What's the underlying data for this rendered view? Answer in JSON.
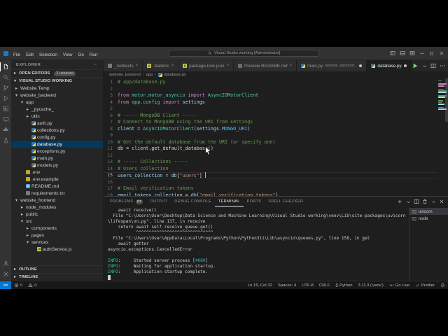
{
  "colors": {
    "accent": "#007acc",
    "remote_badge": "#0078d4",
    "selection": "#04395e",
    "activity_bar": "#333333",
    "sidebar": "#252526",
    "editor_bg": "#1e1e1e"
  },
  "titlebar": {
    "menus": [
      "File",
      "Edit",
      "Selection",
      "View",
      "Go",
      "Run"
    ],
    "command_center": "Visual Studio working [Administrator]",
    "layout_controls": [
      {
        "name": "toggle-sidebar",
        "icon": "layout-sidebar"
      },
      {
        "name": "toggle-panel",
        "icon": "layout-panel"
      },
      {
        "name": "customize-layout",
        "icon": "layout-custom"
      }
    ],
    "window_controls": [
      {
        "name": "minimize",
        "icon": "min"
      },
      {
        "name": "maximize",
        "icon": "max"
      },
      {
        "name": "close-window",
        "icon": "close"
      }
    ]
  },
  "activity_bar": {
    "top": [
      {
        "name": "explorer",
        "icon": "files",
        "active": true
      },
      {
        "name": "search",
        "icon": "search",
        "active": false
      },
      {
        "name": "source-control",
        "icon": "source-control",
        "active": false
      },
      {
        "name": "run-debug",
        "icon": "debug",
        "active": false
      },
      {
        "name": "extensions",
        "icon": "extensions",
        "active": false
      },
      {
        "name": "remote-explorer",
        "icon": "remote-window",
        "active": false
      },
      {
        "name": "docker",
        "icon": "docker",
        "active": false
      },
      {
        "name": "testing",
        "icon": "beaker",
        "active": false
      }
    ],
    "bottom": [
      {
        "name": "accounts",
        "icon": "account"
      },
      {
        "name": "settings",
        "icon": "gear"
      }
    ]
  },
  "sidebar": {
    "title": "EXPLORER",
    "open_editors": {
      "label": "OPEN EDITORS",
      "badge": "2 unsaved"
    },
    "root_label": "VISUAL STUDIO WORKING",
    "outline_label": "OUTLINE",
    "timeline_label": "TIMELINE",
    "tree": [
      {
        "label": "Website Temp",
        "indent": 0,
        "chev": "right",
        "icon": "folder"
      },
      {
        "label": "website_backend",
        "indent": 0,
        "chev": "down",
        "icon": "folder"
      },
      {
        "label": "app",
        "indent": 1,
        "chev": "down",
        "icon": "folder"
      },
      {
        "label": "_pycache_",
        "indent": 2,
        "chev": "right",
        "icon": "folder"
      },
      {
        "label": "utils",
        "indent": 2,
        "chev": "right",
        "icon": "folder"
      },
      {
        "label": "auth.py",
        "indent": 2,
        "icon": "py"
      },
      {
        "label": "collections.py",
        "indent": 2,
        "icon": "py"
      },
      {
        "label": "config.py",
        "indent": 2,
        "icon": "py"
      },
      {
        "label": "database.py",
        "indent": 2,
        "icon": "py",
        "selected": true
      },
      {
        "label": "exceptions.py",
        "indent": 2,
        "icon": "py"
      },
      {
        "label": "main.py",
        "indent": 2,
        "icon": "py"
      },
      {
        "label": "models.py",
        "indent": 2,
        "icon": "py"
      },
      {
        "label": ".env",
        "indent": 1,
        "icon": "env"
      },
      {
        "label": ".env.example",
        "indent": 1,
        "icon": "env"
      },
      {
        "label": "README.md",
        "indent": 1,
        "icon": "md"
      },
      {
        "label": "requirements.txt",
        "indent": 1,
        "icon": "txt"
      },
      {
        "label": "website_frontend",
        "indent": 0,
        "chev": "down",
        "icon": "folder"
      },
      {
        "label": "node_modules",
        "indent": 1,
        "chev": "right",
        "icon": "folder"
      },
      {
        "label": "public",
        "indent": 1,
        "chev": "right",
        "icon": "folder"
      },
      {
        "label": "src",
        "indent": 1,
        "chev": "down",
        "icon": "folder"
      },
      {
        "label": "components",
        "indent": 2,
        "chev": "right",
        "icon": "folder"
      },
      {
        "label": "pages",
        "indent": 2,
        "chev": "right",
        "icon": "folder"
      },
      {
        "label": "services",
        "indent": 2,
        "chev": "down",
        "icon": "folder"
      },
      {
        "label": "authService.js",
        "indent": 3,
        "icon": "js"
      }
    ]
  },
  "tabs": [
    {
      "label": "_redirects",
      "icon": "txt",
      "modified": false,
      "active": false
    },
    {
      "label": ".babelrc",
      "icon": "json",
      "modified": false,
      "active": false
    },
    {
      "label": "package-lock.json",
      "icon": "json",
      "modified": false,
      "active": false
    },
    {
      "label": "Preview README.md",
      "icon": "preview",
      "modified": false,
      "active": false
    },
    {
      "label": "main.py",
      "desc": "website_backend...",
      "icon": "py",
      "modified": true,
      "active": false
    },
    {
      "label": "database.py",
      "icon": "py",
      "modified": true,
      "active": true
    }
  ],
  "tab_actions": [
    {
      "name": "run-python-file",
      "icon": "play",
      "color": "#89d185"
    },
    {
      "name": "run-dropdown",
      "icon": "chevron-down",
      "color": "#c0c0c0"
    },
    {
      "name": "split-editor",
      "icon": "split",
      "color": "#c0c0c0"
    },
    {
      "name": "more-actions",
      "icon": "ellipsis",
      "color": "#c0c0c0"
    }
  ],
  "breadcrumb": [
    {
      "label": "website_backend"
    },
    {
      "label": "app"
    },
    {
      "label": "database.py",
      "icon": "py"
    }
  ],
  "editor": {
    "current_line": 15,
    "cursor_col": 32,
    "lines": [
      [
        {
          "t": "# app/database.py",
          "c": "cm"
        }
      ],
      [],
      [
        {
          "t": "from ",
          "c": "kw"
        },
        {
          "t": "motor.motor_asyncio ",
          "c": "ty"
        },
        {
          "t": "import ",
          "c": "kw"
        },
        {
          "t": "AsyncIOMotorClient",
          "c": "ty"
        }
      ],
      [
        {
          "t": "from ",
          "c": "kw"
        },
        {
          "t": "app.config ",
          "c": "ty"
        },
        {
          "t": "import ",
          "c": "kw"
        },
        {
          "t": "settings",
          "c": "vr"
        }
      ],
      [],
      [
        {
          "t": "# ----- MongoDB Client -----",
          "c": "cm"
        }
      ],
      [
        {
          "t": "# Connect to MongoDB using the URI from settings",
          "c": "cm"
        }
      ],
      [
        {
          "t": "client",
          "c": "vr"
        },
        {
          "t": " = ",
          "c": "df"
        },
        {
          "t": "AsyncIOMotorClient",
          "c": "ty"
        },
        {
          "t": "(",
          "c": "df"
        },
        {
          "t": "settings",
          "c": "vr"
        },
        {
          "t": ".",
          "c": "df"
        },
        {
          "t": "MONGO_URI",
          "c": "ct"
        },
        {
          "t": ")",
          "c": "df"
        }
      ],
      [],
      [
        {
          "t": "# Get the default database from the URI (or specify one)",
          "c": "cm"
        }
      ],
      [
        {
          "t": "db",
          "c": "vr"
        },
        {
          "t": " = ",
          "c": "df"
        },
        {
          "t": "client",
          "c": "vr"
        },
        {
          "t": ".",
          "c": "df"
        },
        {
          "t": "get_default_database",
          "c": "fn"
        },
        {
          "t": "()",
          "c": "df"
        }
      ],
      [],
      [
        {
          "t": "# ----- Collections -----",
          "c": "cm"
        }
      ],
      [
        {
          "t": "# Users collection",
          "c": "cm"
        }
      ],
      [
        {
          "t": "users_collection",
          "c": "vr"
        },
        {
          "t": " = ",
          "c": "df"
        },
        {
          "t": "db",
          "c": "vr"
        },
        {
          "t": "[",
          "c": "df"
        },
        {
          "t": "\"users\"",
          "c": "st"
        },
        {
          "t": "] ",
          "c": "df"
        }
      ],
      [],
      [
        {
          "t": "# Email verification tokens",
          "c": "cm"
        }
      ],
      [
        {
          "t": "email_tokens_collection",
          "c": "vr"
        },
        {
          "t": " = ",
          "c": "df"
        },
        {
          "t": "db",
          "c": "vr"
        },
        {
          "t": "[",
          "c": "df"
        },
        {
          "t": "\"email_verification_tokens\"",
          "c": "st"
        },
        {
          "t": "]",
          "c": "df"
        }
      ]
    ]
  },
  "panel": {
    "tabs": [
      {
        "label": "PROBLEMS",
        "badge": "67",
        "active": false
      },
      {
        "label": "OUTPUT",
        "active": false
      },
      {
        "label": "DEBUG CONSOLE",
        "active": false
      },
      {
        "label": "TERMINAL",
        "active": true
      },
      {
        "label": "PORTS",
        "active": false
      },
      {
        "label": "SPELL CHECKER",
        "active": false
      }
    ],
    "actions": [
      {
        "name": "new-terminal",
        "icon": "plus"
      },
      {
        "name": "terminal-dropdown",
        "icon": "chevron-down"
      },
      {
        "name": "split-terminal",
        "icon": "split"
      },
      {
        "name": "kill-terminal",
        "icon": "trash"
      },
      {
        "name": "maximize-panel",
        "icon": "chevron-up"
      },
      {
        "name": "close-panel",
        "icon": "close"
      }
    ]
  },
  "terminal": {
    "lines": [
      [
        {
          "t": "    await receive()",
          "c": "df"
        }
      ],
      [
        {
          "t": "  File \"C:\\Users\\User\\Desktop\\Data Science and Machine Learning\\Visual Studio working\\venv\\Lib\\site-packages\\uvicorn\\lifespan\\on.py\", line 137, in receive",
          "c": "df"
        }
      ],
      [
        {
          "t": "    return await self.receive_queue.get()",
          "c": "df"
        }
      ],
      [
        {
          "t": "           ^^^^^^^^^^^^^^^^^^^^^^^^^^^^^^",
          "c": "df"
        }
      ],
      [
        {
          "t": "  File \"C:\\Users\\User\\AppData\\Local\\Programs\\Python\\Python311\\Lib\\asyncio\\queues.py\", line 158, in get",
          "c": "df"
        }
      ],
      [
        {
          "t": "    await getter",
          "c": "df"
        }
      ],
      [
        {
          "t": "asyncio.exceptions.CancelledError",
          "c": "df"
        }
      ],
      [],
      [
        {
          "t": "INFO",
          "c": "gr"
        },
        {
          "t": ":     Started server process [",
          "c": "df"
        },
        {
          "t": "4080",
          "c": "cy"
        },
        {
          "t": "]",
          "c": "df"
        }
      ],
      [
        {
          "t": "INFO",
          "c": "gr"
        },
        {
          "t": ":     Waiting for application startup.",
          "c": "df"
        }
      ],
      [
        {
          "t": "INFO",
          "c": "gr"
        },
        {
          "t": ":     Application startup complete.",
          "c": "df"
        }
      ]
    ],
    "cursor": true,
    "list": [
      {
        "label": "uvicorn",
        "icon": "terminal",
        "selected": true
      },
      {
        "label": "node",
        "icon": "terminal",
        "selected": false
      }
    ]
  },
  "statusbar": {
    "left": [
      {
        "name": "problems-errors",
        "icon": "error",
        "text": "0"
      },
      {
        "name": "problems-warnings",
        "icon": "warning",
        "text": "0"
      }
    ],
    "right": [
      {
        "name": "cursor-position",
        "text": "Ln 15, Col 32"
      },
      {
        "name": "indentation",
        "text": "Spaces: 4"
      },
      {
        "name": "encoding",
        "text": "UTF-8"
      },
      {
        "name": "eol",
        "text": "CRLF"
      },
      {
        "name": "language-mode",
        "icon": "braces",
        "text": "Python"
      },
      {
        "name": "python-interpreter",
        "text": "3.11.9 ('venv')"
      },
      {
        "name": "go-live",
        "icon": "broadcast",
        "text": "Go Live"
      },
      {
        "name": "prettier",
        "icon": "check",
        "text": "Prettier"
      },
      {
        "name": "notifications",
        "icon": "bell",
        "text": ""
      }
    ]
  }
}
